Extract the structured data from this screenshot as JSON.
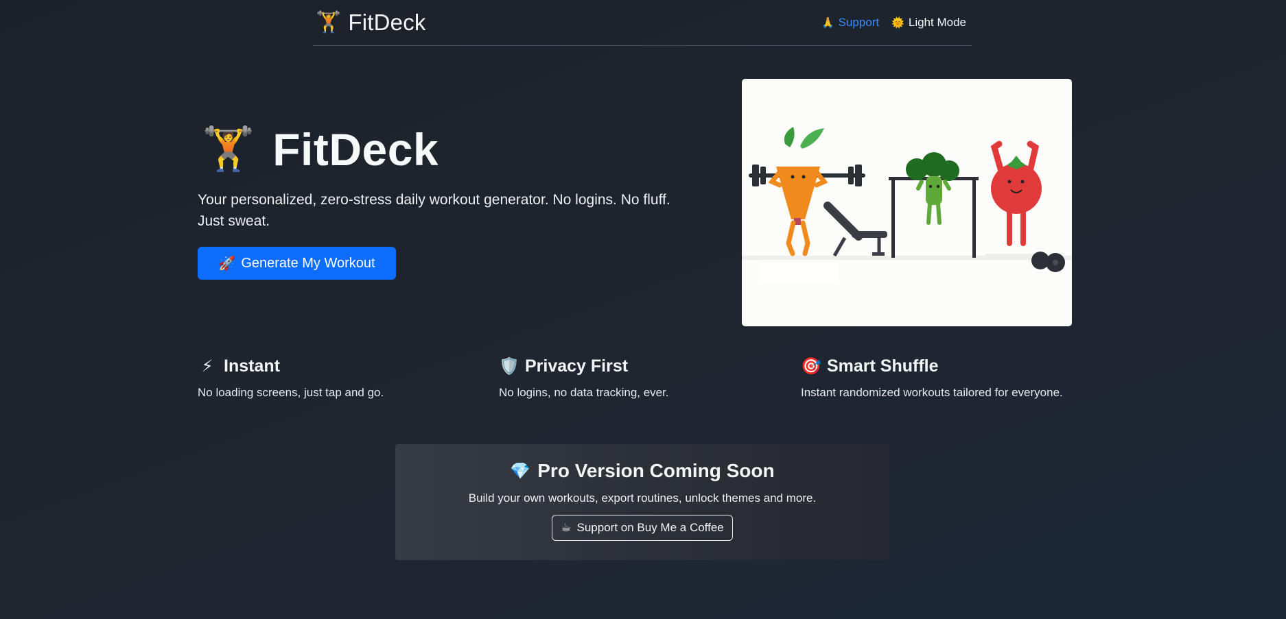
{
  "navbar": {
    "brand_icon": "🏋️",
    "brand_name": "FitDeck",
    "support_icon": "🙏",
    "support_label": "Support",
    "light_icon": "🌞",
    "light_label": "Light Mode"
  },
  "hero": {
    "icon": "🏋️",
    "title": "FitDeck",
    "subtitle": "Your personalized, zero-stress daily workout generator. No logins. No fluff. Just sweat.",
    "cta_icon": "🚀",
    "cta_label": "Generate My Workout",
    "illustration": "veggie-gym-illustration"
  },
  "features": [
    {
      "icon": "⚡",
      "title": "Instant",
      "desc": "No loading screens, just tap and go."
    },
    {
      "icon": "🛡️",
      "title": "Privacy First",
      "desc": "No logins, no data tracking, ever."
    },
    {
      "icon": "🎯",
      "title": "Smart Shuffle",
      "desc": "Instant randomized workouts tailored for everyone."
    }
  ],
  "pro": {
    "icon": "💎",
    "title": "Pro Version Coming Soon",
    "desc": "Build your own workouts, export routines, unlock themes and more.",
    "button_icon": "☕",
    "button_label": "Support on Buy Me a Coffee"
  },
  "colors": {
    "accent": "#0d6efd",
    "link": "#3d8bfd",
    "background": "#1f2630"
  }
}
